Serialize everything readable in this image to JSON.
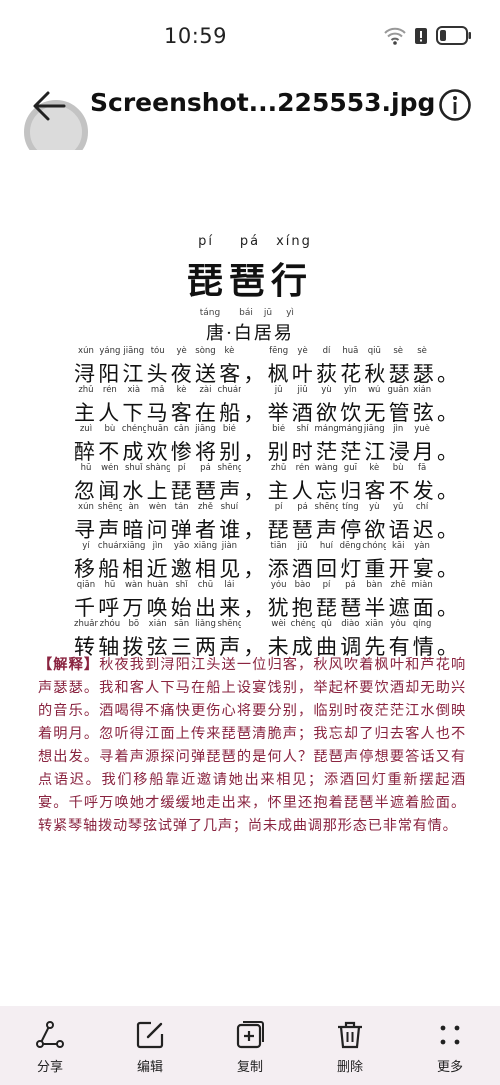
{
  "status_bar": {
    "time": "10:59"
  },
  "header": {
    "file_name": "Screenshot...225553.jpg"
  },
  "poem": {
    "title_pinyin": [
      "pí",
      "pá",
      "xíng"
    ],
    "title": "琵琶行",
    "author_pinyin": [
      "táng",
      "bái",
      "jū",
      "yì"
    ],
    "author": "唐·白居易",
    "lines": [
      {
        "pinyin": [
          "xún",
          "yáng",
          "jiāng",
          "tóu",
          "yè",
          "sòng",
          "kè",
          "fēng",
          "yè",
          "dí",
          "huā",
          "qiū",
          "sè",
          "sè"
        ],
        "text": "浔阳江头夜送客，枫叶荻花秋瑟瑟。"
      },
      {
        "pinyin": [
          "zhǔ",
          "rén",
          "xià",
          "mǎ",
          "kè",
          "zài",
          "chuán",
          "jǔ",
          "jiǔ",
          "yù",
          "yǐn",
          "wú",
          "guǎn",
          "xián"
        ],
        "text": "主人下马客在船，举酒欲饮无管弦。"
      },
      {
        "pinyin": [
          "zuì",
          "bù",
          "chéng",
          "huān",
          "cǎn",
          "jiāng",
          "bié",
          "bié",
          "shí",
          "máng",
          "máng",
          "jiāng",
          "jìn",
          "yuè"
        ],
        "text": "醉不成欢惨将别，别时茫茫江浸月。"
      },
      {
        "pinyin": [
          "hū",
          "wén",
          "shuǐ",
          "shàng",
          "pí",
          "pá",
          "shēng",
          "zhǔ",
          "rén",
          "wàng",
          "guī",
          "kè",
          "bù",
          "fā"
        ],
        "text": "忽闻水上琵琶声，主人忘归客不发。"
      },
      {
        "pinyin": [
          "xún",
          "shēng",
          "àn",
          "wèn",
          "tán",
          "zhě",
          "shuí",
          "pí",
          "pá",
          "shēng",
          "tíng",
          "yù",
          "yǔ",
          "chí"
        ],
        "text": "寻声暗问弹者谁，琵琶声停欲语迟。"
      },
      {
        "pinyin": [
          "yí",
          "chuán",
          "xiāng",
          "jìn",
          "yāo",
          "xiāng",
          "jiàn",
          "tiān",
          "jiǔ",
          "huí",
          "dēng",
          "chóng",
          "kāi",
          "yàn"
        ],
        "text": "移船相近邀相见，添酒回灯重开宴。"
      },
      {
        "pinyin": [
          "qiān",
          "hū",
          "wàn",
          "huàn",
          "shǐ",
          "chū",
          "lái",
          "yóu",
          "bào",
          "pí",
          "pá",
          "bàn",
          "zhē",
          "miàn"
        ],
        "text": "千呼万唤始出来，犹抱琵琶半遮面。"
      },
      {
        "pinyin": [
          "zhuǎn",
          "zhóu",
          "bō",
          "xián",
          "sān",
          "liǎng",
          "shēng",
          "wèi",
          "chéng",
          "qǔ",
          "diào",
          "xiān",
          "yǒu",
          "qíng"
        ],
        "text": "转轴拨弦三两声，未成曲调先有情。"
      }
    ],
    "explanation_tag": "【解释】",
    "explanation": "秋夜我到浔阳江头送一位归客，秋风吹着枫叶和芦花响声瑟瑟。我和客人下马在船上设宴饯别，举起杯要饮酒却无助兴的音乐。酒喝得不痛快更伤心将要分别，临别时夜茫茫江水倒映着明月。忽听得江面上传来琵琶清脆声；我忘却了归去客人也不想出发。寻着声源探问弹琵琶的是何人？琵琶声停想要答话又有点语迟。我们移船靠近邀请她出来相见；添酒回灯重新摆起酒宴。千呼万唤她才缓缓地走出来，怀里还抱着琵琶半遮着脸面。转紧琴轴拨动琴弦试弹了几声；尚未成曲调那形态已非常有情。"
  },
  "toolbar": {
    "share_label": "分享",
    "edit_label": "编辑",
    "copy_label": "复制",
    "delete_label": "删除",
    "more_label": "更多"
  },
  "icons": [
    "wifi-icon",
    "alert-icon",
    "battery-icon",
    "back-arrow-icon",
    "info-icon",
    "share-icon",
    "edit-icon",
    "copy-icon",
    "delete-icon",
    "more-icon"
  ]
}
